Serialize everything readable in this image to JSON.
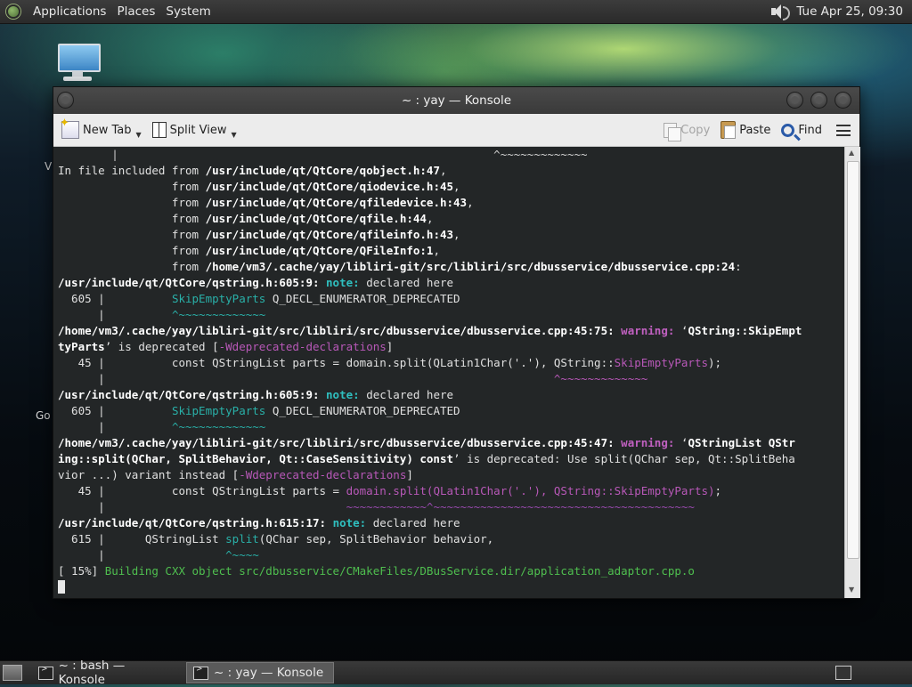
{
  "top_panel": {
    "menus": [
      "Applications",
      "Places",
      "System"
    ],
    "clock": "Tue Apr 25, 09:30",
    "icons": [
      "distro-logo-icon",
      "volume-icon"
    ]
  },
  "desktop": {
    "labels": [
      "V",
      "Go"
    ]
  },
  "window": {
    "title": "~ : yay — Konsole",
    "toolbar": {
      "new_tab": "New Tab",
      "split_view": "Split View",
      "copy": "Copy",
      "paste": "Paste",
      "find": "Find"
    }
  },
  "terminal": {
    "lines": [
      [
        "dim",
        "        |                                                        ^~~~~~~~~~~~~~"
      ],
      [
        "",
        "In file included from ",
        "b",
        "/usr/include/qt/QtCore/qobject.h:47",
        "",
        ","
      ],
      [
        "",
        "                 from ",
        "b",
        "/usr/include/qt/QtCore/qiodevice.h:45",
        "",
        ","
      ],
      [
        "",
        "                 from ",
        "b",
        "/usr/include/qt/QtCore/qfiledevice.h:43",
        "",
        ","
      ],
      [
        "",
        "                 from ",
        "b",
        "/usr/include/qt/QtCore/qfile.h:44",
        "",
        ","
      ],
      [
        "",
        "                 from ",
        "b",
        "/usr/include/qt/QtCore/qfileinfo.h:43",
        "",
        ","
      ],
      [
        "",
        "                 from ",
        "b",
        "/usr/include/qt/QtCore/QFileInfo:1",
        "",
        ","
      ],
      [
        "",
        "                 from ",
        "b",
        "/home/vm3/.cache/yay/libliri-git/src/libliri/src/dbusservice/dbusservice.cpp:24",
        "",
        ":"
      ],
      [
        "b",
        "/usr/include/qt/QtCore/qstring.h:605:9:",
        "",
        " ",
        "note",
        "note:",
        "",
        " declared here"
      ],
      [
        "",
        "  605 |          ",
        "tl",
        "SkipEmptyParts",
        "",
        " Q_DECL_ENUMERATOR_DEPRECATED"
      ],
      [
        "",
        "      |          ",
        "tl",
        "^~~~~~~~~~~~~~"
      ],
      [
        "b",
        "/home/vm3/.cache/yay/libliri-git/src/libliri/src/dbusservice/dbusservice.cpp:45:75:",
        "",
        " ",
        "warn",
        "warning:",
        "",
        " ‘",
        "b",
        "QString::SkipEmpt"
      ],
      [
        "b",
        "tyParts",
        "",
        "’ is deprecated [",
        "mg",
        "-Wdeprecated-declarations",
        "",
        "]"
      ],
      [
        "",
        "   45 |          const QStringList parts = domain.split(QLatin1Char('.'), QString::",
        "mg",
        "SkipEmptyParts",
        "",
        ");"
      ],
      [
        "",
        "      |                                                                   ",
        "mg",
        "^~~~~~~~~~~~~~"
      ],
      [
        "b",
        "/usr/include/qt/QtCore/qstring.h:605:9:",
        "",
        " ",
        "note",
        "note:",
        "",
        " declared here"
      ],
      [
        "",
        "  605 |          ",
        "tl",
        "SkipEmptyParts",
        "",
        " Q_DECL_ENUMERATOR_DEPRECATED"
      ],
      [
        "",
        "      |          ",
        "tl",
        "^~~~~~~~~~~~~~"
      ],
      [
        "b",
        "/home/vm3/.cache/yay/libliri-git/src/libliri/src/dbusservice/dbusservice.cpp:45:47:",
        "",
        " ",
        "warn",
        "warning:",
        "",
        " ‘",
        "b",
        "QStringList QStr"
      ],
      [
        "b",
        "ing::split(QChar, SplitBehavior, Qt::CaseSensitivity) const",
        "",
        "’ is deprecated: Use split(QChar sep, Qt::SplitBeha"
      ],
      [
        "",
        "vior ...) variant instead [",
        "mg",
        "-Wdeprecated-declarations",
        "",
        "]"
      ],
      [
        "",
        "   45 |          const QStringList parts = ",
        "mg",
        "domain.split(QLatin1Char('.'), QString::SkipEmptyParts)",
        "",
        ";"
      ],
      [
        "",
        "      |                                    ",
        "cr",
        "~~~~~~~~~~~~^~~~~~~~~~~~~~~~~~~~~~~~~~~~~~~~~~~~~~~~"
      ],
      [
        "b",
        "/usr/include/qt/QtCore/qstring.h:615:17:",
        "",
        " ",
        "note",
        "note:",
        "",
        " declared here"
      ],
      [
        "",
        "  615 |      QStringList ",
        "tl",
        "split",
        "",
        "(QChar sep, SplitBehavior behavior,"
      ],
      [
        "",
        "      |                  ",
        "tl",
        "^~~~~"
      ],
      [
        "",
        "[ 15%] ",
        "gr",
        "Building CXX object src/dbusservice/CMakeFiles/DBusService.dir/application_adaptor.cpp.o"
      ]
    ]
  },
  "taskbar": {
    "tasks": [
      {
        "label": "~ : bash — Konsole",
        "active": false
      },
      {
        "label": "~ : yay — Konsole",
        "active": true
      }
    ]
  }
}
